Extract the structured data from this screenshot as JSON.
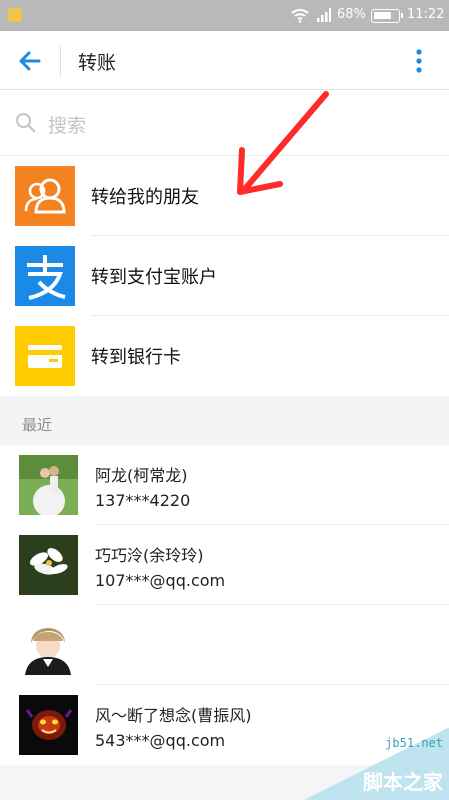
{
  "status_bar": {
    "battery_percent": "68%",
    "time": "11:22"
  },
  "app_bar": {
    "title": "转账"
  },
  "search": {
    "placeholder": "搜索"
  },
  "actions": [
    {
      "label": "转给我的朋友",
      "color": "#f58220"
    },
    {
      "label": "转到支付宝账户",
      "color": "#1a8ae6"
    },
    {
      "label": "转到银行卡",
      "color": "#ffcc00"
    }
  ],
  "recent_section": {
    "label": "最近"
  },
  "contacts": [
    {
      "name": "阿龙(柯常龙)",
      "account": "137***4220"
    },
    {
      "name": "巧巧泠(余玲玲)",
      "account": "107***@qq.com"
    },
    {
      "name": "",
      "account": ""
    },
    {
      "name": "风～断了想念(曹振风)",
      "account": "543***@qq.com"
    }
  ],
  "watermark": {
    "domain": "jb51.net",
    "brand": "脚本之家"
  },
  "colors": {
    "accent": "#1a8ae6",
    "annotation": "#ff2a2a"
  }
}
